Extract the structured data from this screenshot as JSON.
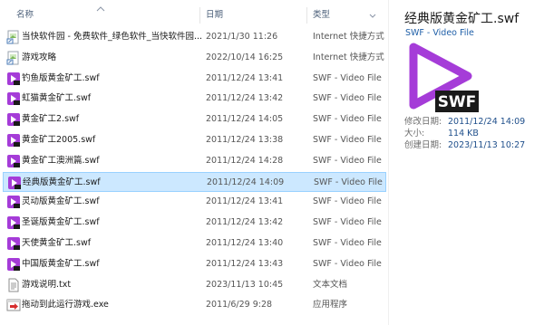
{
  "columns": {
    "name": "名称",
    "date": "日期",
    "type": "类型"
  },
  "files": [
    {
      "name": "当快软件园 - 免费软件_绿色软件_当快软件园...",
      "date": "2021/1/30 11:26",
      "type": "Internet 快捷方式",
      "icon": "internet-shortcut-icon"
    },
    {
      "name": "游戏攻略",
      "date": "2022/10/14 16:25",
      "type": "Internet 快捷方式",
      "icon": "internet-shortcut-icon"
    },
    {
      "name": "钓鱼版黄金矿工.swf",
      "date": "2011/12/24 13:41",
      "type": "SWF - Video File",
      "icon": "swf-file-icon"
    },
    {
      "name": "虹猫黄金矿工.swf",
      "date": "2011/12/24 13:42",
      "type": "SWF - Video File",
      "icon": "swf-file-icon"
    },
    {
      "name": "黄金矿工2.swf",
      "date": "2011/12/24 14:05",
      "type": "SWF - Video File",
      "icon": "swf-file-icon"
    },
    {
      "name": "黄金矿工2005.swf",
      "date": "2011/12/24 13:38",
      "type": "SWF - Video File",
      "icon": "swf-file-icon"
    },
    {
      "name": "黄金矿工澳洲篇.swf",
      "date": "2011/12/24 14:28",
      "type": "SWF - Video File",
      "icon": "swf-file-icon"
    },
    {
      "name": "经典版黄金矿工.swf",
      "date": "2011/12/24 14:09",
      "type": "SWF - Video File",
      "icon": "swf-file-icon",
      "selected": true
    },
    {
      "name": "灵动版黄金矿工.swf",
      "date": "2011/12/24 13:41",
      "type": "SWF - Video File",
      "icon": "swf-file-icon"
    },
    {
      "name": "圣诞版黄金矿工.swf",
      "date": "2011/12/24 13:42",
      "type": "SWF - Video File",
      "icon": "swf-file-icon"
    },
    {
      "name": "天使黄金矿工.swf",
      "date": "2011/12/24 13:40",
      "type": "SWF - Video File",
      "icon": "swf-file-icon"
    },
    {
      "name": "中国版黄金矿工.swf",
      "date": "2011/12/24 13:43",
      "type": "SWF - Video File",
      "icon": "swf-file-icon"
    },
    {
      "name": "游戏说明.txt",
      "date": "2023/11/13 10:45",
      "type": "文本文档",
      "icon": "text-file-icon"
    },
    {
      "name": "拖动到此运行游戏.exe",
      "date": "2011/6/29 9:28",
      "type": "应用程序",
      "icon": "exe-file-icon"
    }
  ],
  "preview": {
    "title": "经典版黄金矿工.swf",
    "subtitle": "SWF - Video File",
    "icon": "swf-large-icon",
    "icon_badge": "SWF",
    "meta": [
      {
        "key": "修改日期:",
        "value": "2011/12/24 14:09"
      },
      {
        "key": "大小:",
        "value": "114 KB"
      },
      {
        "key": "创建日期:",
        "value": "2023/11/13 10:27"
      }
    ]
  },
  "colors": {
    "selection_bg": "#cce8ff",
    "selection_border": "#99d1ff",
    "swf_purple": "#a53cd8",
    "link_blue": "#1f5fa8"
  }
}
